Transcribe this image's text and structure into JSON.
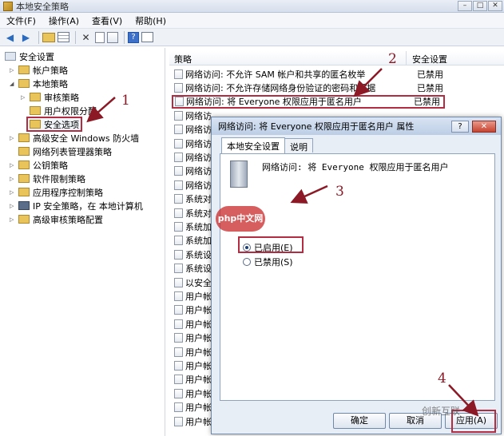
{
  "window": {
    "title": "本地安全策略"
  },
  "menu": [
    "文件(F)",
    "操作(A)",
    "查看(V)",
    "帮助(H)"
  ],
  "tree": [
    {
      "label": "安全设置",
      "level": 0,
      "expander": "",
      "icon": "root"
    },
    {
      "label": "帐户策略",
      "level": 1,
      "expander": "▷",
      "icon": "folder"
    },
    {
      "label": "本地策略",
      "level": 1,
      "expander": "◢",
      "icon": "folder"
    },
    {
      "label": "审核策略",
      "level": 2,
      "expander": "▷",
      "icon": "folder"
    },
    {
      "label": "用户权限分配",
      "level": 2,
      "expander": "",
      "icon": "folder"
    },
    {
      "label": "安全选项",
      "level": 2,
      "expander": "",
      "icon": "lock"
    },
    {
      "label": "高级安全 Windows 防火墙",
      "level": 1,
      "expander": "▷",
      "icon": "folder"
    },
    {
      "label": "网络列表管理器策略",
      "level": 1,
      "expander": "",
      "icon": "folder"
    },
    {
      "label": "公钥策略",
      "level": 1,
      "expander": "▷",
      "icon": "folder"
    },
    {
      "label": "软件限制策略",
      "level": 1,
      "expander": "▷",
      "icon": "folder"
    },
    {
      "label": "应用程序控制策略",
      "level": 1,
      "expander": "▷",
      "icon": "folder"
    },
    {
      "label": "IP 安全策略，在 本地计算机",
      "level": 1,
      "expander": "▷",
      "icon": "ipsec"
    },
    {
      "label": "高级审核策略配置",
      "level": 1,
      "expander": "▷",
      "icon": "folder"
    }
  ],
  "list": {
    "headers": {
      "policy": "策略",
      "setting": "安全设置"
    },
    "rows": [
      {
        "name": "网络访问: 不允许 SAM 帐户和共享的匿名枚举",
        "status": "已禁用"
      },
      {
        "name": "网络访问: 不允许存储网络身份验证的密码和凭据",
        "status": "已禁用"
      },
      {
        "name": "网络访问: 将 Everyone 权限应用于匿名用户",
        "status": "已禁用"
      },
      {
        "name": "网络访",
        "status": ""
      },
      {
        "name": "网络访",
        "status": ""
      },
      {
        "name": "网络访",
        "status": ""
      },
      {
        "name": "网络访",
        "status": ""
      },
      {
        "name": "网络访",
        "status": ""
      },
      {
        "name": "网络访",
        "status": ""
      },
      {
        "name": "系统对",
        "status": ""
      },
      {
        "name": "系统对",
        "status": ""
      },
      {
        "name": "系统加",
        "status": ""
      },
      {
        "name": "系统加",
        "status": ""
      },
      {
        "name": "系统设",
        "status": ""
      },
      {
        "name": "系统设",
        "status": ""
      },
      {
        "name": "以安全",
        "status": ""
      },
      {
        "name": "用户帐",
        "status": ""
      },
      {
        "name": "用户帐",
        "status": ""
      },
      {
        "name": "用户帐",
        "status": ""
      },
      {
        "name": "用户帐",
        "status": ""
      },
      {
        "name": "用户帐",
        "status": ""
      },
      {
        "name": "用户帐",
        "status": ""
      },
      {
        "name": "用户帐",
        "status": ""
      },
      {
        "name": "用户帐",
        "status": ""
      },
      {
        "name": "用户帐",
        "status": ""
      },
      {
        "name": "用户帐",
        "status": ""
      }
    ]
  },
  "dialog": {
    "title": "网络访问: 将 Everyone 权限应用于匿名用户 属性",
    "help": "?",
    "close": "✕",
    "tabs": [
      "本地安全设置",
      "说明"
    ],
    "policy_name": "网络访问: 将 Everyone 权限应用于匿名用户",
    "options": [
      {
        "label": "已启用(E)",
        "checked": true
      },
      {
        "label": "已禁用(S)",
        "checked": false
      }
    ],
    "buttons": {
      "ok": "确定",
      "cancel": "取消",
      "apply": "应用(A)"
    }
  },
  "annotations": [
    "1",
    "2",
    "3",
    "4"
  ],
  "watermarks": {
    "site": "php中文网",
    "wechat": "创新互联"
  },
  "colors": {
    "annotation": "#b32d42",
    "title_bg": "#d6dfec",
    "selection_border": "#b32d42"
  }
}
